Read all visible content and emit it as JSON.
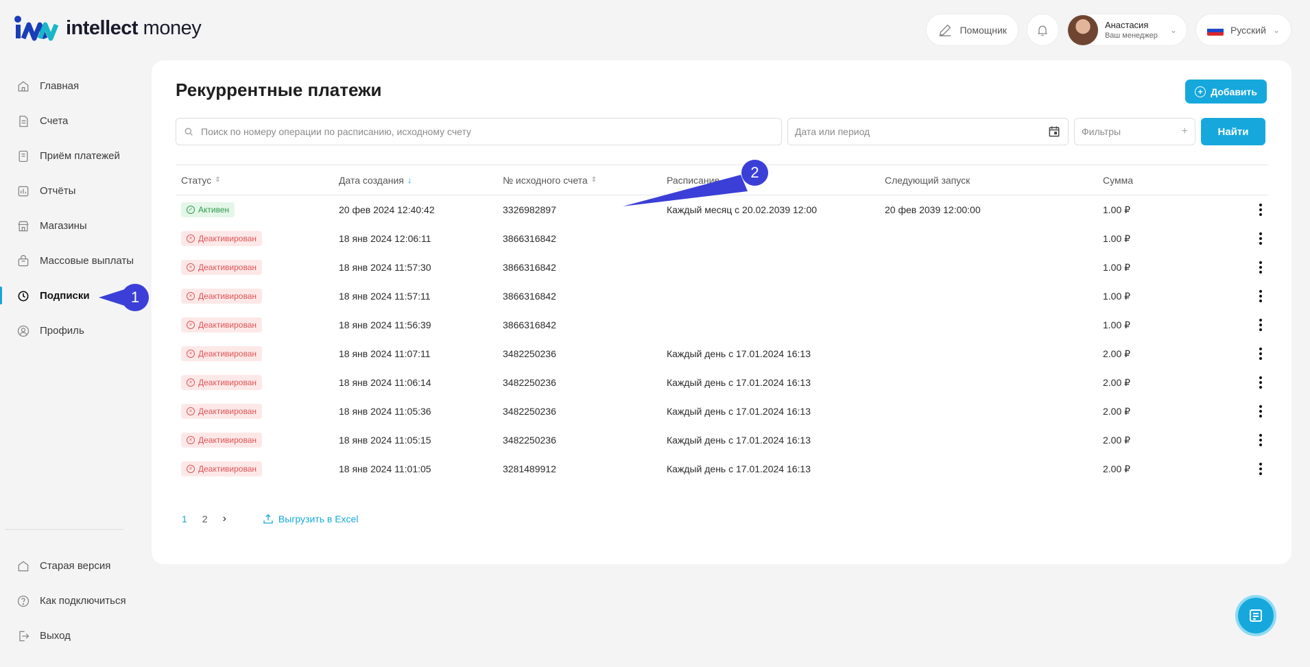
{
  "brand": {
    "name_bold": "intellect",
    "name_regular": "money"
  },
  "topbar": {
    "assistant_label": "Помощник",
    "user_name": "Анастасия",
    "user_role": "Ваш менеджер",
    "language": "Русский"
  },
  "sidebar": {
    "items": [
      {
        "label": "Главная",
        "icon": "home-icon"
      },
      {
        "label": "Счета",
        "icon": "document-icon"
      },
      {
        "label": "Приём платежей",
        "icon": "receipt-icon"
      },
      {
        "label": "Отчёты",
        "icon": "chart-icon"
      },
      {
        "label": "Магазины",
        "icon": "store-icon"
      },
      {
        "label": "Массовые выплаты",
        "icon": "bag-icon"
      },
      {
        "label": "Подписки",
        "icon": "clock-icon",
        "active": true
      },
      {
        "label": "Профиль",
        "icon": "user-icon"
      }
    ],
    "bottom": [
      {
        "label": "Старая версия",
        "icon": "home-icon"
      },
      {
        "label": "Как подключиться",
        "icon": "help-icon"
      },
      {
        "label": "Выход",
        "icon": "logout-icon"
      }
    ]
  },
  "page": {
    "title": "Рекуррентные платежи",
    "add_label": "Добавить",
    "search_placeholder": "Поиск по номеру операции по расписанию, исходному счету",
    "date_placeholder": "Дата или период",
    "filters_label": "Фильтры",
    "find_label": "Найти"
  },
  "table": {
    "headers": [
      "Статус",
      "Дата создания",
      "№ исходного счета",
      "Расписание",
      "Следующий запуск",
      "Сумма"
    ],
    "rows": [
      {
        "status": "Активен",
        "status_type": "active",
        "created": "20 фев 2024 12:40:42",
        "account": "3326982897",
        "schedule": "Каждый месяц с 20.02.2039 12:00",
        "next": "20 фев 2039 12:00:00",
        "amount": "1.00 ₽"
      },
      {
        "status": "Деактивирован",
        "status_type": "inactive",
        "created": "18 янв 2024 12:06:11",
        "account": "3866316842",
        "schedule": "",
        "next": "",
        "amount": "1.00 ₽"
      },
      {
        "status": "Деактивирован",
        "status_type": "inactive",
        "created": "18 янв 2024 11:57:30",
        "account": "3866316842",
        "schedule": "",
        "next": "",
        "amount": "1.00 ₽"
      },
      {
        "status": "Деактивирован",
        "status_type": "inactive",
        "created": "18 янв 2024 11:57:11",
        "account": "3866316842",
        "schedule": "",
        "next": "",
        "amount": "1.00 ₽"
      },
      {
        "status": "Деактивирован",
        "status_type": "inactive",
        "created": "18 янв 2024 11:56:39",
        "account": "3866316842",
        "schedule": "",
        "next": "",
        "amount": "1.00 ₽"
      },
      {
        "status": "Деактивирован",
        "status_type": "inactive",
        "created": "18 янв 2024 11:07:11",
        "account": "3482250236",
        "schedule": "Каждый день с 17.01.2024 16:13",
        "next": "",
        "amount": "2.00 ₽"
      },
      {
        "status": "Деактивирован",
        "status_type": "inactive",
        "created": "18 янв 2024 11:06:14",
        "account": "3482250236",
        "schedule": "Каждый день с 17.01.2024 16:13",
        "next": "",
        "amount": "2.00 ₽"
      },
      {
        "status": "Деактивирован",
        "status_type": "inactive",
        "created": "18 янв 2024 11:05:36",
        "account": "3482250236",
        "schedule": "Каждый день с 17.01.2024 16:13",
        "next": "",
        "amount": "2.00 ₽"
      },
      {
        "status": "Деактивирован",
        "status_type": "inactive",
        "created": "18 янв 2024 11:05:15",
        "account": "3482250236",
        "schedule": "Каждый день с 17.01.2024 16:13",
        "next": "",
        "amount": "2.00 ₽"
      },
      {
        "status": "Деактивирован",
        "status_type": "inactive",
        "created": "18 янв 2024 11:01:05",
        "account": "3281489912",
        "schedule": "Каждый день с 17.01.2024 16:13",
        "next": "",
        "amount": "2.00 ₽"
      }
    ]
  },
  "pagination": {
    "pages": [
      "1",
      "2"
    ],
    "current": "1",
    "export_label": "Выгрузить в Excel"
  },
  "annotations": [
    "1",
    "2"
  ],
  "colors": {
    "accent": "#16a8dc",
    "active_green": "#2e9a4d",
    "inactive_red": "#e05454",
    "marker": "#3b3fd8"
  }
}
